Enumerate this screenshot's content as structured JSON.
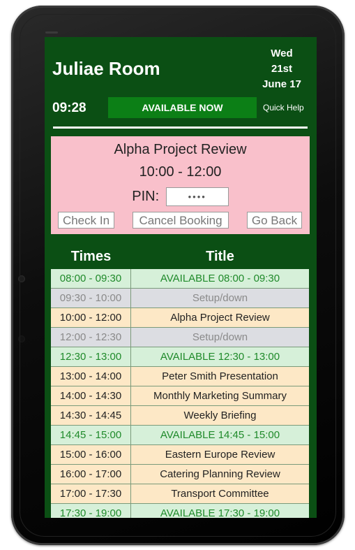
{
  "room": {
    "name": "Juliae Room"
  },
  "date": {
    "day": "Wed",
    "date": "21st",
    "month_year": "June 17"
  },
  "clock": "09:28",
  "status": "AVAILABLE NOW",
  "help_label": "Quick Help",
  "booking": {
    "title": "Alpha Project Review",
    "time": "10:00 - 12:00",
    "pin_label": "PIN:",
    "pin_value": "••••",
    "check_in": "Check In",
    "cancel": "Cancel Booking",
    "go_back": "Go Back"
  },
  "schedule": {
    "headers": {
      "times": "Times",
      "title": "Title"
    },
    "rows": [
      {
        "time": "08:00 - 09:30",
        "title": "AVAILABLE 08:00 - 09:30",
        "type": "available"
      },
      {
        "time": "09:30 - 10:00",
        "title": "Setup/down",
        "type": "setup"
      },
      {
        "time": "10:00 - 12:00",
        "title": "Alpha Project Review",
        "type": "booked"
      },
      {
        "time": "12:00 - 12:30",
        "title": "Setup/down",
        "type": "setup"
      },
      {
        "time": "12:30 - 13:00",
        "title": "AVAILABLE 12:30 - 13:00",
        "type": "available"
      },
      {
        "time": "13:00 - 14:00",
        "title": "Peter Smith Presentation",
        "type": "booked"
      },
      {
        "time": "14:00 - 14:30",
        "title": "Monthly Marketing Summary",
        "type": "booked"
      },
      {
        "time": "14:30 - 14:45",
        "title": "Weekly Briefing",
        "type": "booked"
      },
      {
        "time": "14:45 - 15:00",
        "title": "AVAILABLE 14:45 - 15:00",
        "type": "available"
      },
      {
        "time": "15:00 - 16:00",
        "title": "Eastern Europe Review",
        "type": "booked"
      },
      {
        "time": "16:00 - 17:00",
        "title": "Catering Planning Review",
        "type": "booked"
      },
      {
        "time": "17:00 - 17:30",
        "title": "Transport Committee",
        "type": "booked"
      },
      {
        "time": "17:30 - 19:00",
        "title": "AVAILABLE 17:30 - 19:00",
        "type": "available"
      }
    ]
  },
  "colors": {
    "screen_bg": "#0b4f14",
    "status_bg": "#0c7f16",
    "booking_bg": "#f9c0cb",
    "available_row": "#d6f0d9",
    "setup_row": "#dcdde2",
    "booked_row": "#fde8c6"
  }
}
